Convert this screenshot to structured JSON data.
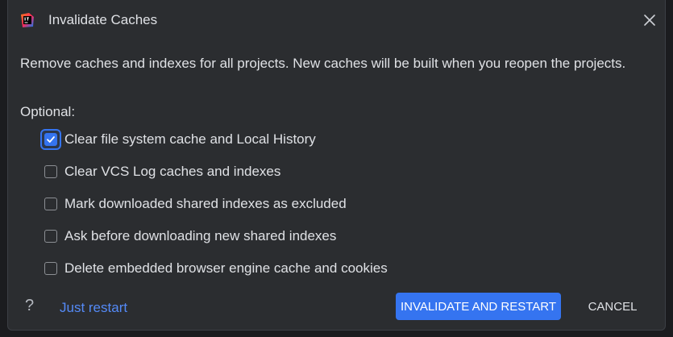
{
  "dialog": {
    "title": "Invalidate Caches",
    "app_icon": "intellij-idea-icon",
    "close_icon": "close-icon"
  },
  "description": "Remove caches and indexes for all projects. New caches will be built when you reopen the projects.",
  "optional_label": "Optional:",
  "options": [
    {
      "label": "Clear file system cache and Local History",
      "checked": true
    },
    {
      "label": "Clear VCS Log caches and indexes",
      "checked": false
    },
    {
      "label": "Mark downloaded shared indexes as excluded",
      "checked": false
    },
    {
      "label": "Ask before downloading new shared indexes",
      "checked": false
    },
    {
      "label": "Delete embedded browser engine cache and cookies",
      "checked": false
    }
  ],
  "footer": {
    "help_label": "?",
    "just_restart_label": "Just restart",
    "invalidate_label": "INVALIDATE AND RESTART",
    "cancel_label": "CANCEL"
  },
  "colors": {
    "accent": "#3574f0",
    "link": "#548af7",
    "dialog_bg": "#2b2d30",
    "text": "#dfe1e5"
  }
}
